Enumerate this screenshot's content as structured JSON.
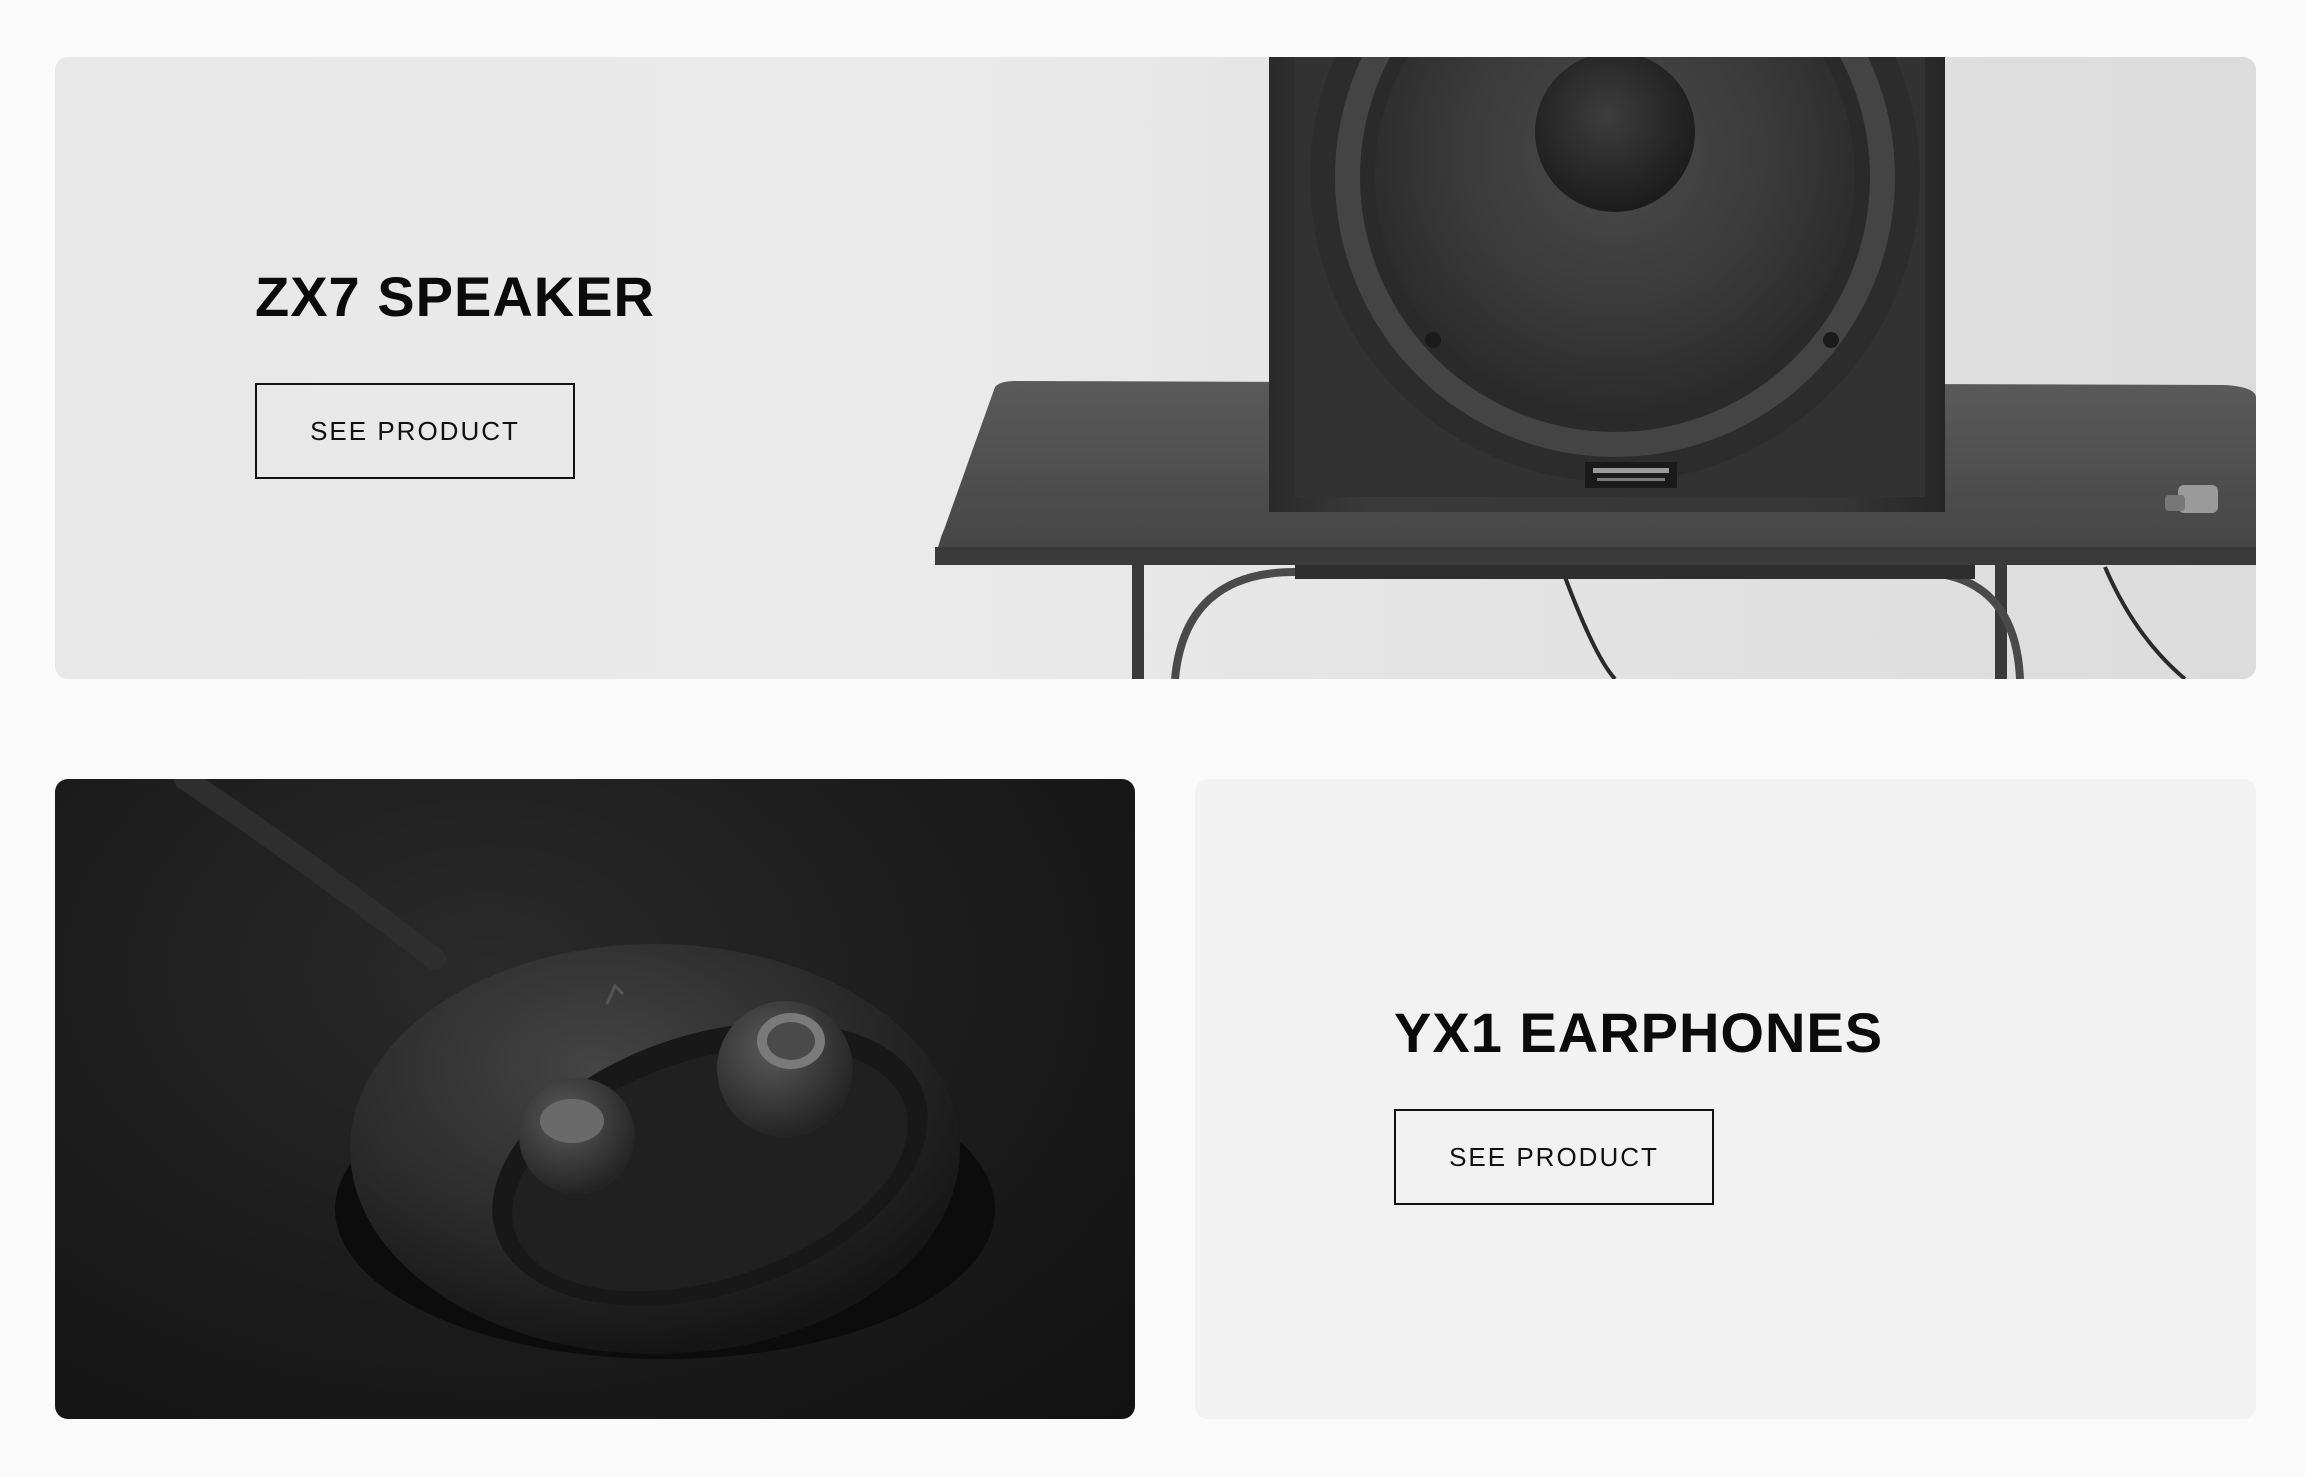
{
  "speaker": {
    "title": "ZX7 SPEAKER",
    "button_label": "SEE PRODUCT"
  },
  "earphones": {
    "title": "YX1 EARPHONES",
    "button_label": "SEE PRODUCT"
  },
  "colors": {
    "page_bg": "#fafafa",
    "text": "#0b0b0b",
    "card_light": "#f2f2f2",
    "card_dark": "#1b1b1b"
  },
  "images": {
    "speaker": "speaker-on-table-image",
    "earphones": "earphones-case-image"
  }
}
